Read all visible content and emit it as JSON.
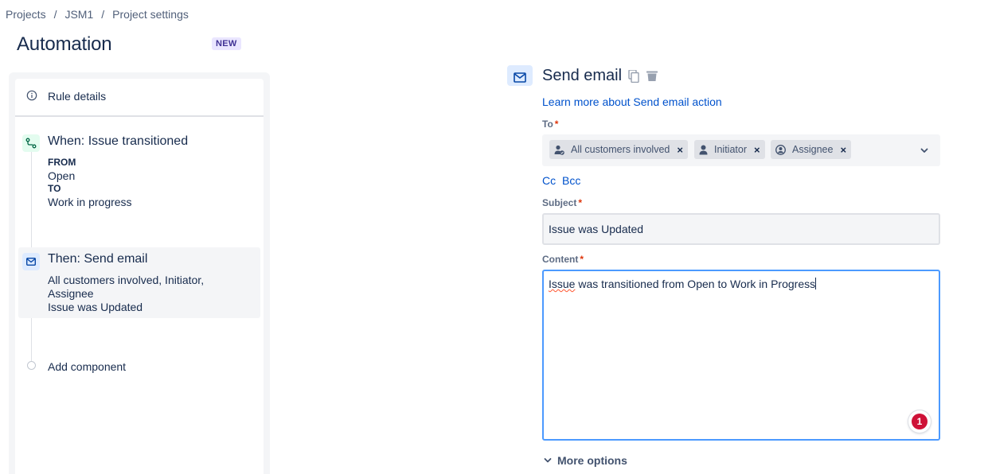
{
  "breadcrumb": {
    "items": [
      "Projects",
      "JSM1",
      "Project settings"
    ],
    "separator": "/"
  },
  "header": {
    "title": "Automation",
    "badge": "NEW"
  },
  "rule_panel": {
    "rule_details_label": "Rule details",
    "trigger": {
      "title": "When: Issue transitioned",
      "from_label": "FROM",
      "from_value": "Open",
      "to_label": "TO",
      "to_value": "Work in progress"
    },
    "action": {
      "title": "Then: Send email",
      "recipients": "All customers involved, Initiator, Assignee",
      "subject": "Issue was Updated"
    },
    "add_component_label": "Add component"
  },
  "editor": {
    "title": "Send email",
    "learn_more": "Learn more about Send email action",
    "to": {
      "label": "To",
      "recipients": [
        "All customers involved",
        "Initiator",
        "Assignee"
      ]
    },
    "cc_label": "Cc",
    "bcc_label": "Bcc",
    "subject": {
      "label": "Subject",
      "value": "Issue was Updated"
    },
    "content": {
      "label": "Content",
      "spell_word": "Issue",
      "value_rest": " was transitioned from Open to Work in Progress",
      "notification_count": "1"
    },
    "more_options_label": "More options"
  },
  "colors": {
    "link": "#0052CC",
    "text": "#172B4D",
    "focus_border": "#4C9AFF",
    "required": "#DE350B",
    "badge_bg": "#EAE6FF",
    "badge_text": "#403294",
    "error_badge": "#CE1137"
  }
}
